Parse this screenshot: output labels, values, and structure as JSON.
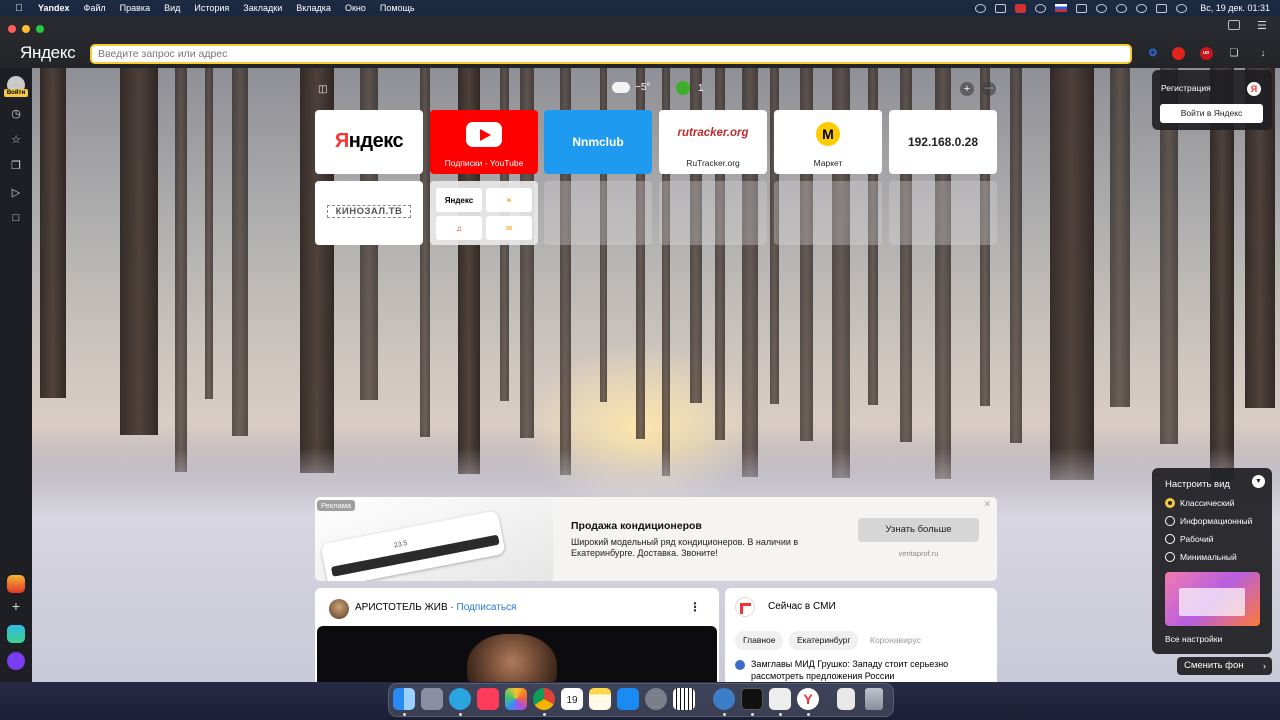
{
  "menubar": {
    "app_name": "Yandex",
    "menus": [
      "Файл",
      "Правка",
      "Вид",
      "История",
      "Закладки",
      "Вкладка",
      "Окно",
      "Помощь"
    ],
    "clock": "Вс, 19 дек.  01:31"
  },
  "browser": {
    "brand": "Яндекс",
    "address_placeholder": "Введите запрос или адрес",
    "accent": "#f4cd34"
  },
  "sidebar": {
    "login_label": "Войти",
    "items": [
      "history-icon",
      "bookmark-star-icon",
      "collections-icon",
      "video-play-icon",
      "counter-icon"
    ]
  },
  "weather": {
    "temp": "−5°"
  },
  "traffic": {
    "score": "1"
  },
  "tiles": [
    {
      "id": "yandex",
      "logo": "Яндекс",
      "caption": ""
    },
    {
      "id": "youtube",
      "logo": "",
      "caption": "Подписки - YouTube"
    },
    {
      "id": "nnm",
      "logo": "Nnmclub",
      "caption": ""
    },
    {
      "id": "rutracker",
      "logo": "rutracker.org",
      "caption": "RuTracker.org"
    },
    {
      "id": "market",
      "logo": "M",
      "caption": "Маркет"
    },
    {
      "id": "ip",
      "logo": "192.168.0.28",
      "caption": ""
    },
    {
      "id": "kino",
      "logo": "КИНОЗАЛ.ТВ",
      "caption": ""
    }
  ],
  "folder_tile": {
    "items": [
      "Яндекс",
      "weather",
      "music",
      "mail"
    ]
  },
  "ad": {
    "label": "Реклама",
    "title": "Продажа кондиционеров",
    "text": "Широкий модельный ряд кондиционеров. В наличии в Екатеринбурге. Доставка. Звоните!",
    "button": "Узнать больше",
    "domain": "ventaprof.ru",
    "device_display": "23.5"
  },
  "zen": {
    "channel": "АРИСТОТЕЛЬ ЖИВ",
    "separator": " · ",
    "subscribe": "Подписаться"
  },
  "news": {
    "header": "Сейчас в СМИ",
    "tabs": [
      "Главное",
      "Екатеринбург",
      "Коронавирус"
    ],
    "item": "Замглавы МИД Грушко: Западу стоит серьезно рассмотреть предложения России"
  },
  "register_panel": {
    "label": "Регистрация",
    "button": "Войти в Яндекс"
  },
  "view_panel": {
    "title": "Настроить вид",
    "options": [
      "Классический",
      "Информационный",
      "Рабочий",
      "Минимальный"
    ],
    "selected": 0,
    "all_settings": "Все настройки"
  },
  "change_background": "Сменить фон",
  "dock": {
    "apps": [
      "finder-icon",
      "launchpad-icon",
      "telegram-icon",
      "music-icon",
      "photos-icon",
      "chrome-icon",
      "calendar-icon",
      "notes-icon",
      "app-store-icon",
      "system-preferences-icon",
      "piano-icon",
      "qbittorrent-icon",
      "terminal-icon",
      "textedit-icon",
      "yandex-browser-icon",
      "document-icon",
      "trash-icon"
    ],
    "calendar_day": "19"
  }
}
